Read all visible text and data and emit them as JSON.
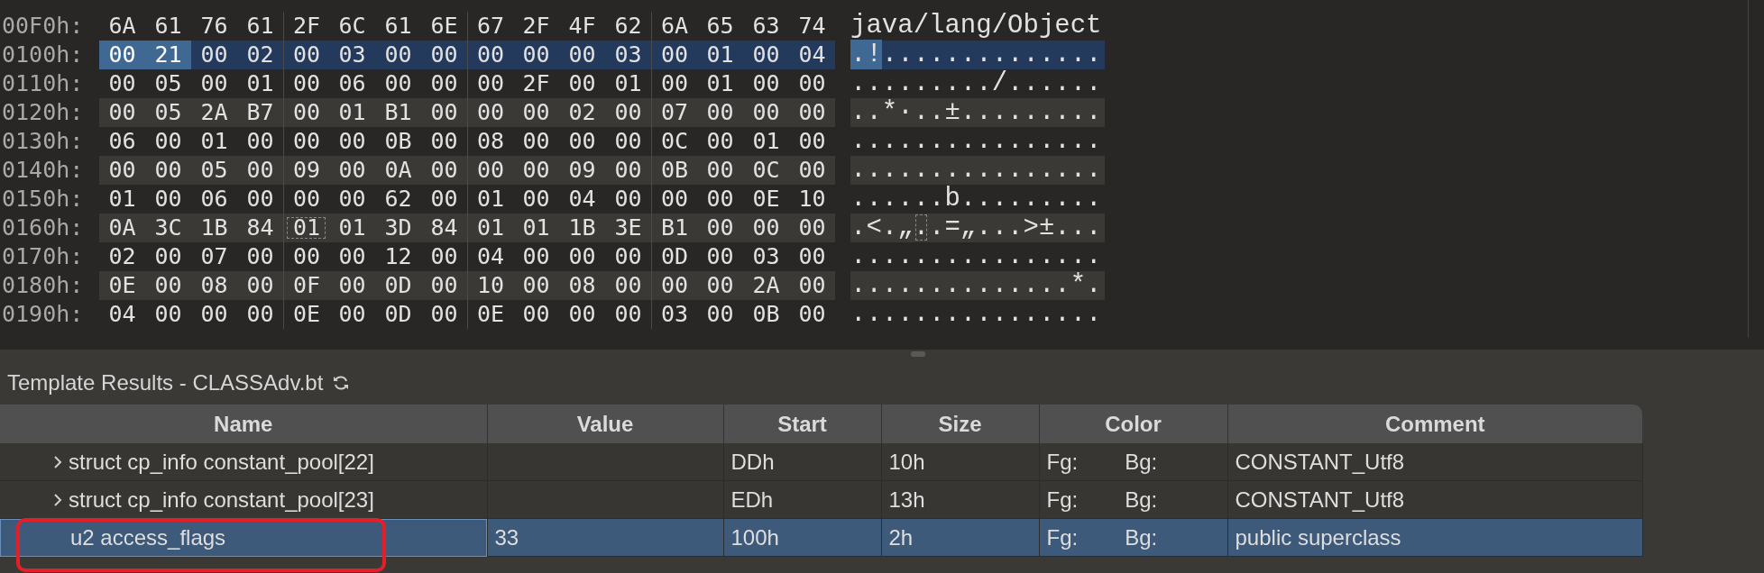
{
  "hex_view": {
    "rows": [
      {
        "address": "00F0h:",
        "selected": false,
        "ascii": "java/lang/Object",
        "bytes": [
          {
            "text": "6A",
            "selected": false,
            "outlined": false
          },
          {
            "text": "61",
            "selected": false,
            "outlined": false
          },
          {
            "text": "76",
            "selected": false,
            "outlined": false
          },
          {
            "text": "61",
            "selected": false,
            "outlined": false
          },
          {
            "text": "2F",
            "selected": false,
            "outlined": false
          },
          {
            "text": "6C",
            "selected": false,
            "outlined": false
          },
          {
            "text": "61",
            "selected": false,
            "outlined": false
          },
          {
            "text": "6E",
            "selected": false,
            "outlined": false
          },
          {
            "text": "67",
            "selected": false,
            "outlined": false
          },
          {
            "text": "2F",
            "selected": false,
            "outlined": false
          },
          {
            "text": "4F",
            "selected": false,
            "outlined": false
          },
          {
            "text": "62",
            "selected": false,
            "outlined": false
          },
          {
            "text": "6A",
            "selected": false,
            "outlined": false
          },
          {
            "text": "65",
            "selected": false,
            "outlined": false
          },
          {
            "text": "63",
            "selected": false,
            "outlined": false
          },
          {
            "text": "74",
            "selected": false,
            "outlined": false
          }
        ]
      },
      {
        "address": "0100h:",
        "selected": true,
        "ascii": ".!..............",
        "bytes": [
          {
            "text": "00",
            "selected": true,
            "outlined": false
          },
          {
            "text": "21",
            "selected": true,
            "outlined": false
          },
          {
            "text": "00",
            "selected": false,
            "outlined": false
          },
          {
            "text": "02",
            "selected": false,
            "outlined": false
          },
          {
            "text": "00",
            "selected": false,
            "outlined": false
          },
          {
            "text": "03",
            "selected": false,
            "outlined": false
          },
          {
            "text": "00",
            "selected": false,
            "outlined": false
          },
          {
            "text": "00",
            "selected": false,
            "outlined": false
          },
          {
            "text": "00",
            "selected": false,
            "outlined": false
          },
          {
            "text": "00",
            "selected": false,
            "outlined": false
          },
          {
            "text": "00",
            "selected": false,
            "outlined": false
          },
          {
            "text": "03",
            "selected": false,
            "outlined": false
          },
          {
            "text": "00",
            "selected": false,
            "outlined": false
          },
          {
            "text": "01",
            "selected": false,
            "outlined": false
          },
          {
            "text": "00",
            "selected": false,
            "outlined": false
          },
          {
            "text": "04",
            "selected": false,
            "outlined": false
          }
        ]
      },
      {
        "address": "0110h:",
        "selected": false,
        "ascii": "........./......",
        "bytes": [
          {
            "text": "00",
            "selected": false,
            "outlined": false
          },
          {
            "text": "05",
            "selected": false,
            "outlined": false
          },
          {
            "text": "00",
            "selected": false,
            "outlined": false
          },
          {
            "text": "01",
            "selected": false,
            "outlined": false
          },
          {
            "text": "00",
            "selected": false,
            "outlined": false
          },
          {
            "text": "06",
            "selected": false,
            "outlined": false
          },
          {
            "text": "00",
            "selected": false,
            "outlined": false
          },
          {
            "text": "00",
            "selected": false,
            "outlined": false
          },
          {
            "text": "00",
            "selected": false,
            "outlined": false
          },
          {
            "text": "2F",
            "selected": false,
            "outlined": false
          },
          {
            "text": "00",
            "selected": false,
            "outlined": false
          },
          {
            "text": "01",
            "selected": false,
            "outlined": false
          },
          {
            "text": "00",
            "selected": false,
            "outlined": false
          },
          {
            "text": "01",
            "selected": false,
            "outlined": false
          },
          {
            "text": "00",
            "selected": false,
            "outlined": false
          },
          {
            "text": "00",
            "selected": false,
            "outlined": false
          }
        ]
      },
      {
        "address": "0120h:",
        "selected": false,
        "ascii": "..*·..±.........",
        "bytes": [
          {
            "text": "00",
            "selected": false,
            "outlined": false
          },
          {
            "text": "05",
            "selected": false,
            "outlined": false
          },
          {
            "text": "2A",
            "selected": false,
            "outlined": false
          },
          {
            "text": "B7",
            "selected": false,
            "outlined": false
          },
          {
            "text": "00",
            "selected": false,
            "outlined": false
          },
          {
            "text": "01",
            "selected": false,
            "outlined": false
          },
          {
            "text": "B1",
            "selected": false,
            "outlined": false
          },
          {
            "text": "00",
            "selected": false,
            "outlined": false
          },
          {
            "text": "00",
            "selected": false,
            "outlined": false
          },
          {
            "text": "00",
            "selected": false,
            "outlined": false
          },
          {
            "text": "02",
            "selected": false,
            "outlined": false
          },
          {
            "text": "00",
            "selected": false,
            "outlined": false
          },
          {
            "text": "07",
            "selected": false,
            "outlined": false
          },
          {
            "text": "00",
            "selected": false,
            "outlined": false
          },
          {
            "text": "00",
            "selected": false,
            "outlined": false
          },
          {
            "text": "00",
            "selected": false,
            "outlined": false
          }
        ]
      },
      {
        "address": "0130h:",
        "selected": false,
        "ascii": "................",
        "bytes": [
          {
            "text": "06",
            "selected": false,
            "outlined": false
          },
          {
            "text": "00",
            "selected": false,
            "outlined": false
          },
          {
            "text": "01",
            "selected": false,
            "outlined": false
          },
          {
            "text": "00",
            "selected": false,
            "outlined": false
          },
          {
            "text": "00",
            "selected": false,
            "outlined": false
          },
          {
            "text": "00",
            "selected": false,
            "outlined": false
          },
          {
            "text": "0B",
            "selected": false,
            "outlined": false
          },
          {
            "text": "00",
            "selected": false,
            "outlined": false
          },
          {
            "text": "08",
            "selected": false,
            "outlined": false
          },
          {
            "text": "00",
            "selected": false,
            "outlined": false
          },
          {
            "text": "00",
            "selected": false,
            "outlined": false
          },
          {
            "text": "00",
            "selected": false,
            "outlined": false
          },
          {
            "text": "0C",
            "selected": false,
            "outlined": false
          },
          {
            "text": "00",
            "selected": false,
            "outlined": false
          },
          {
            "text": "01",
            "selected": false,
            "outlined": false
          },
          {
            "text": "00",
            "selected": false,
            "outlined": false
          }
        ]
      },
      {
        "address": "0140h:",
        "selected": false,
        "ascii": "................",
        "bytes": [
          {
            "text": "00",
            "selected": false,
            "outlined": false
          },
          {
            "text": "00",
            "selected": false,
            "outlined": false
          },
          {
            "text": "05",
            "selected": false,
            "outlined": false
          },
          {
            "text": "00",
            "selected": false,
            "outlined": false
          },
          {
            "text": "09",
            "selected": false,
            "outlined": false
          },
          {
            "text": "00",
            "selected": false,
            "outlined": false
          },
          {
            "text": "0A",
            "selected": false,
            "outlined": false
          },
          {
            "text": "00",
            "selected": false,
            "outlined": false
          },
          {
            "text": "00",
            "selected": false,
            "outlined": false
          },
          {
            "text": "00",
            "selected": false,
            "outlined": false
          },
          {
            "text": "09",
            "selected": false,
            "outlined": false
          },
          {
            "text": "00",
            "selected": false,
            "outlined": false
          },
          {
            "text": "0B",
            "selected": false,
            "outlined": false
          },
          {
            "text": "00",
            "selected": false,
            "outlined": false
          },
          {
            "text": "0C",
            "selected": false,
            "outlined": false
          },
          {
            "text": "00",
            "selected": false,
            "outlined": false
          }
        ]
      },
      {
        "address": "0150h:",
        "selected": false,
        "ascii": "......b.........",
        "bytes": [
          {
            "text": "01",
            "selected": false,
            "outlined": false
          },
          {
            "text": "00",
            "selected": false,
            "outlined": false
          },
          {
            "text": "06",
            "selected": false,
            "outlined": false
          },
          {
            "text": "00",
            "selected": false,
            "outlined": false
          },
          {
            "text": "00",
            "selected": false,
            "outlined": false
          },
          {
            "text": "00",
            "selected": false,
            "outlined": false
          },
          {
            "text": "62",
            "selected": false,
            "outlined": false
          },
          {
            "text": "00",
            "selected": false,
            "outlined": false
          },
          {
            "text": "01",
            "selected": false,
            "outlined": false
          },
          {
            "text": "00",
            "selected": false,
            "outlined": false
          },
          {
            "text": "04",
            "selected": false,
            "outlined": false
          },
          {
            "text": "00",
            "selected": false,
            "outlined": false
          },
          {
            "text": "00",
            "selected": false,
            "outlined": false
          },
          {
            "text": "00",
            "selected": false,
            "outlined": false
          },
          {
            "text": "0E",
            "selected": false,
            "outlined": false
          },
          {
            "text": "10",
            "selected": false,
            "outlined": false
          }
        ]
      },
      {
        "address": "0160h:",
        "selected": false,
        "ascii": ".<.„..=„...>±...",
        "bytes": [
          {
            "text": "0A",
            "selected": false,
            "outlined": false
          },
          {
            "text": "3C",
            "selected": false,
            "outlined": false
          },
          {
            "text": "1B",
            "selected": false,
            "outlined": false
          },
          {
            "text": "84",
            "selected": false,
            "outlined": false
          },
          {
            "text": "01",
            "selected": false,
            "outlined": true
          },
          {
            "text": "01",
            "selected": false,
            "outlined": false
          },
          {
            "text": "3D",
            "selected": false,
            "outlined": false
          },
          {
            "text": "84",
            "selected": false,
            "outlined": false
          },
          {
            "text": "01",
            "selected": false,
            "outlined": false
          },
          {
            "text": "01",
            "selected": false,
            "outlined": false
          },
          {
            "text": "1B",
            "selected": false,
            "outlined": false
          },
          {
            "text": "3E",
            "selected": false,
            "outlined": false
          },
          {
            "text": "B1",
            "selected": false,
            "outlined": false
          },
          {
            "text": "00",
            "selected": false,
            "outlined": false
          },
          {
            "text": "00",
            "selected": false,
            "outlined": false
          },
          {
            "text": "00",
            "selected": false,
            "outlined": false
          }
        ]
      },
      {
        "address": "0170h:",
        "selected": false,
        "ascii": "................",
        "bytes": [
          {
            "text": "02",
            "selected": false,
            "outlined": false
          },
          {
            "text": "00",
            "selected": false,
            "outlined": false
          },
          {
            "text": "07",
            "selected": false,
            "outlined": false
          },
          {
            "text": "00",
            "selected": false,
            "outlined": false
          },
          {
            "text": "00",
            "selected": false,
            "outlined": false
          },
          {
            "text": "00",
            "selected": false,
            "outlined": false
          },
          {
            "text": "12",
            "selected": false,
            "outlined": false
          },
          {
            "text": "00",
            "selected": false,
            "outlined": false
          },
          {
            "text": "04",
            "selected": false,
            "outlined": false
          },
          {
            "text": "00",
            "selected": false,
            "outlined": false
          },
          {
            "text": "00",
            "selected": false,
            "outlined": false
          },
          {
            "text": "00",
            "selected": false,
            "outlined": false
          },
          {
            "text": "0D",
            "selected": false,
            "outlined": false
          },
          {
            "text": "00",
            "selected": false,
            "outlined": false
          },
          {
            "text": "03",
            "selected": false,
            "outlined": false
          },
          {
            "text": "00",
            "selected": false,
            "outlined": false
          }
        ]
      },
      {
        "address": "0180h:",
        "selected": false,
        "ascii": "..............*.",
        "bytes": [
          {
            "text": "0E",
            "selected": false,
            "outlined": false
          },
          {
            "text": "00",
            "selected": false,
            "outlined": false
          },
          {
            "text": "08",
            "selected": false,
            "outlined": false
          },
          {
            "text": "00",
            "selected": false,
            "outlined": false
          },
          {
            "text": "0F",
            "selected": false,
            "outlined": false
          },
          {
            "text": "00",
            "selected": false,
            "outlined": false
          },
          {
            "text": "0D",
            "selected": false,
            "outlined": false
          },
          {
            "text": "00",
            "selected": false,
            "outlined": false
          },
          {
            "text": "10",
            "selected": false,
            "outlined": false
          },
          {
            "text": "00",
            "selected": false,
            "outlined": false
          },
          {
            "text": "08",
            "selected": false,
            "outlined": false
          },
          {
            "text": "00",
            "selected": false,
            "outlined": false
          },
          {
            "text": "00",
            "selected": false,
            "outlined": false
          },
          {
            "text": "00",
            "selected": false,
            "outlined": false
          },
          {
            "text": "2A",
            "selected": false,
            "outlined": false
          },
          {
            "text": "00",
            "selected": false,
            "outlined": false
          }
        ]
      },
      {
        "address": "0190h:",
        "selected": false,
        "ascii": "................",
        "bytes": [
          {
            "text": "04",
            "selected": false,
            "outlined": false
          },
          {
            "text": "00",
            "selected": false,
            "outlined": false
          },
          {
            "text": "00",
            "selected": false,
            "outlined": false
          },
          {
            "text": "00",
            "selected": false,
            "outlined": false
          },
          {
            "text": "0E",
            "selected": false,
            "outlined": false
          },
          {
            "text": "00",
            "selected": false,
            "outlined": false
          },
          {
            "text": "0D",
            "selected": false,
            "outlined": false
          },
          {
            "text": "00",
            "selected": false,
            "outlined": false
          },
          {
            "text": "0E",
            "selected": false,
            "outlined": false
          },
          {
            "text": "00",
            "selected": false,
            "outlined": false
          },
          {
            "text": "00",
            "selected": false,
            "outlined": false
          },
          {
            "text": "00",
            "selected": false,
            "outlined": false
          },
          {
            "text": "03",
            "selected": false,
            "outlined": false
          },
          {
            "text": "00",
            "selected": false,
            "outlined": false
          },
          {
            "text": "0B",
            "selected": false,
            "outlined": false
          },
          {
            "text": "00",
            "selected": false,
            "outlined": false
          }
        ]
      }
    ]
  },
  "template_results": {
    "title": "Template Results - CLASSAdv.bt",
    "columns": [
      "Name",
      "Value",
      "Start",
      "Size",
      "Color",
      "Comment"
    ],
    "rows": [
      {
        "expandable": true,
        "name": "struct cp_info constant_pool[22]",
        "start": "DDh",
        "size": "10h",
        "fg": "Fg:",
        "bg": "Bg:",
        "comment": "CONSTANT_Utf8",
        "selected": false,
        "annotated": false
      },
      {
        "expandable": true,
        "name": "struct cp_info constant_pool[23]",
        "start": "EDh",
        "size": "13h",
        "fg": "Fg:",
        "bg": "Bg:",
        "comment": "CONSTANT_Utf8",
        "selected": false,
        "annotated": false
      },
      {
        "expandable": false,
        "name": "u2 access_flags",
        "value": "33",
        "start": "100h",
        "size": "2h",
        "fg": "Fg:",
        "bg": "Bg:",
        "comment": "public superclass",
        "selected": true,
        "annotated": true
      }
    ]
  }
}
